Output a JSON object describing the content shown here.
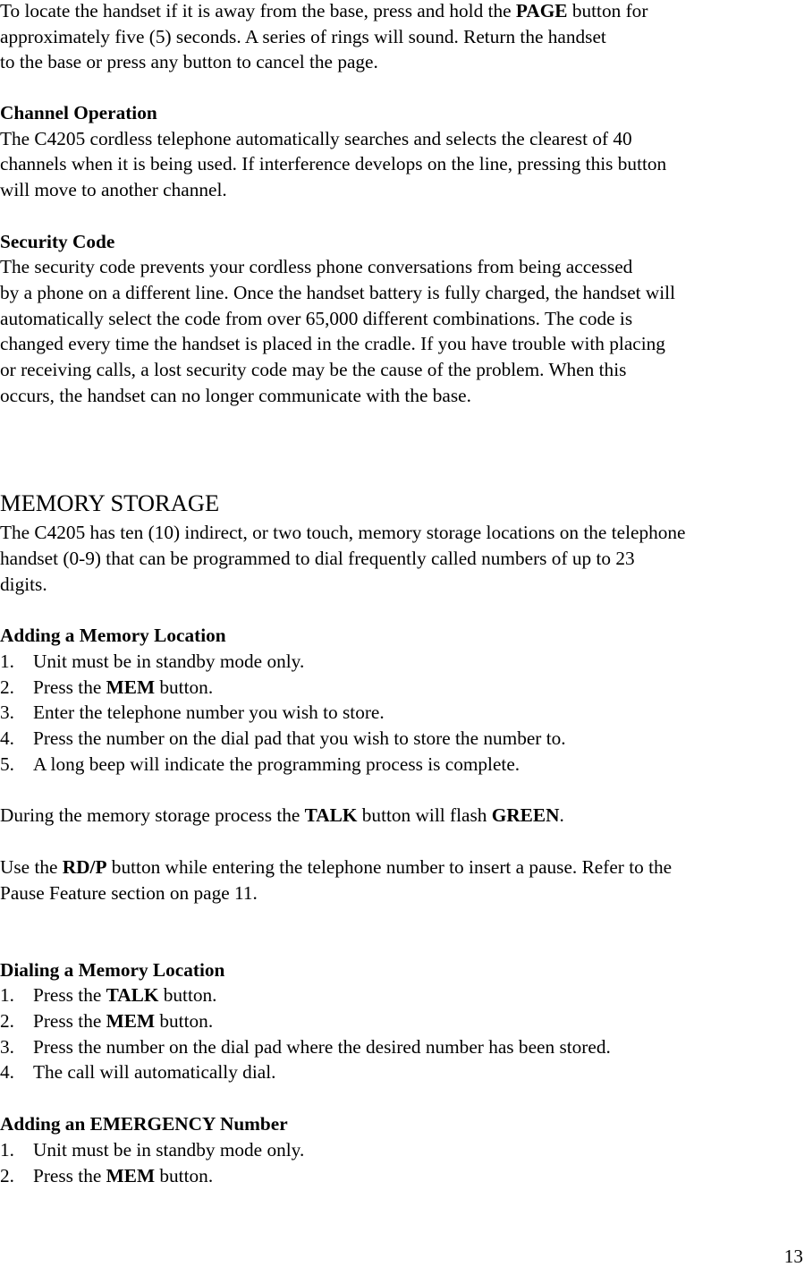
{
  "intro": {
    "lines": [
      [
        "To locate the handset if it is away from the base, press and hold the ",
        "PAGE",
        " button for"
      ],
      [
        "approximately five (5) seconds.  A series of rings will sound.  Return the handset"
      ],
      [
        "to the base or press any button to cancel the page."
      ]
    ]
  },
  "channel_operation": {
    "heading": "Channel Operation",
    "lines": [
      "The C4205 cordless telephone automatically searches and selects the clearest of 40",
      "channels when it is being used. If interference develops on the line, pressing this button",
      "will move to another channel."
    ]
  },
  "security_code": {
    "heading": "Security Code",
    "lines": [
      "The security code prevents your cordless phone conversations from being accessed",
      "by a phone on a different line. Once the handset battery is fully charged, the handset will",
      "automatically select the code from over 65,000 different combinations. The code is",
      "changed every time the handset is placed in the cradle. If you have trouble with placing",
      "or receiving calls, a lost security code may be the cause of the problem. When this",
      "occurs, the handset can no longer communicate with the base."
    ]
  },
  "memory_storage": {
    "title": "MEMORY STORAGE",
    "lines": [
      "The C4205 has ten (10) indirect, or two touch, memory storage locations on the telephone",
      "handset (0-9) that can be programmed to dial frequently called numbers of up to 23",
      "digits."
    ]
  },
  "adding_memory": {
    "heading": "Adding a Memory Location",
    "steps": [
      {
        "num": "1.",
        "pre": "Unit must be in standby mode only.",
        "bold": "",
        "post": ""
      },
      {
        "num": "2.",
        "pre": "Press the ",
        "bold": "MEM",
        "post": " button."
      },
      {
        "num": "3.",
        "pre": "Enter the telephone number you wish to store.",
        "bold": "",
        "post": ""
      },
      {
        "num": "4.",
        "pre": "Press the number on the dial pad that you wish to store the number to.",
        "bold": "",
        "post": ""
      },
      {
        "num": "5.",
        "pre": "A long beep will indicate the programming process is complete.",
        "bold": "",
        "post": ""
      }
    ]
  },
  "notes": {
    "during": {
      "pre": "During the memory storage process the ",
      "b1": "TALK",
      "mid": " button will flash ",
      "b2": "GREEN",
      "post": "."
    },
    "use": {
      "pre": "Use the ",
      "b1": "RD/P",
      "post": " button while entering the telephone number to insert a pause. Refer to the"
    },
    "use_line2": "Pause Feature section on page 11."
  },
  "dialing_memory": {
    "heading": "Dialing a Memory Location",
    "steps": [
      {
        "num": "1.",
        "pre": "Press the ",
        "bold": "TALK",
        "post": " button."
      },
      {
        "num": "2.",
        "pre": "Press the ",
        "bold": "MEM",
        "post": " button."
      },
      {
        "num": "3.",
        "pre": "Press the number on the dial pad where the desired number has been stored.",
        "bold": "",
        "post": ""
      },
      {
        "num": "4.",
        "pre": "The call will automatically dial.",
        "bold": "",
        "post": ""
      }
    ]
  },
  "emergency": {
    "heading": "Adding an EMERGENCY Number",
    "steps": [
      {
        "num": "1.",
        "pre": "Unit must be in standby mode only.",
        "bold": "",
        "post": ""
      },
      {
        "num": "2.",
        "pre": "Press the ",
        "bold": "MEM",
        "post": " button."
      }
    ]
  },
  "page_number": "13"
}
